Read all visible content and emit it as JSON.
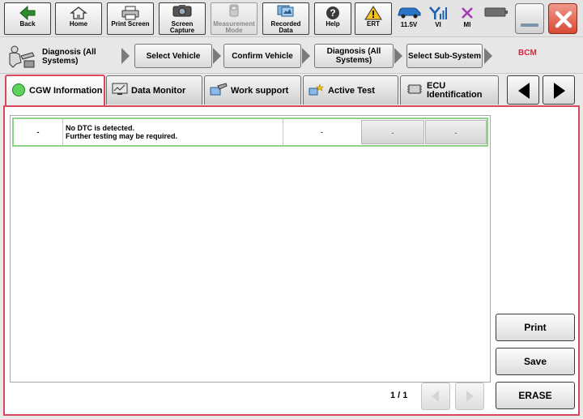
{
  "toolbar": {
    "buttons": [
      {
        "label": "Back",
        "icon": "back-arrow-icon"
      },
      {
        "label": "Home",
        "icon": "home-icon"
      },
      {
        "label": "Print Screen",
        "icon": "printer-icon"
      },
      {
        "label": "Screen Capture",
        "icon": "camera-icon"
      },
      {
        "label": "Measurement Mode",
        "icon": "meter-icon",
        "disabled": true
      },
      {
        "label": "Recorded Data",
        "icon": "recorded-data-icon"
      },
      {
        "label": "Help",
        "icon": "help-icon"
      },
      {
        "label": "ERT",
        "icon": "warning-icon"
      }
    ],
    "status": {
      "battery_voltage": "11.5V",
      "vi_label": "VI",
      "mi_label": "MI"
    }
  },
  "breadcrumb": {
    "home_label": "Diagnosis (All Systems)",
    "items": [
      "Select Vehicle",
      "Confirm Vehicle",
      "Diagnosis (All Systems)",
      "Select Sub-System"
    ],
    "current": "BCM"
  },
  "tabs": [
    {
      "label": "CGW Information",
      "icon": "green-circle-icon",
      "active": true
    },
    {
      "label": "Data Monitor",
      "icon": "monitor-icon"
    },
    {
      "label": "Work support",
      "icon": "work-support-icon"
    },
    {
      "label": "Active Test",
      "icon": "active-test-icon"
    },
    {
      "label": "ECU Identification",
      "icon": "ecu-id-icon"
    }
  ],
  "dtc_list": {
    "rows": [
      {
        "code": "-",
        "description_line1": "No DTC is detected.",
        "description_line2": "Further testing may be required.",
        "ign": "-",
        "b1": "-",
        "b2": "-"
      }
    ]
  },
  "pagination": {
    "text": "1 / 1"
  },
  "actions": {
    "print_label": "Print",
    "save_label": "Save",
    "erase_label": "ERASE"
  },
  "colors": {
    "accent": "#d9465f",
    "row_highlight": "#8fd18b",
    "current_crumb": "#e0203a"
  }
}
